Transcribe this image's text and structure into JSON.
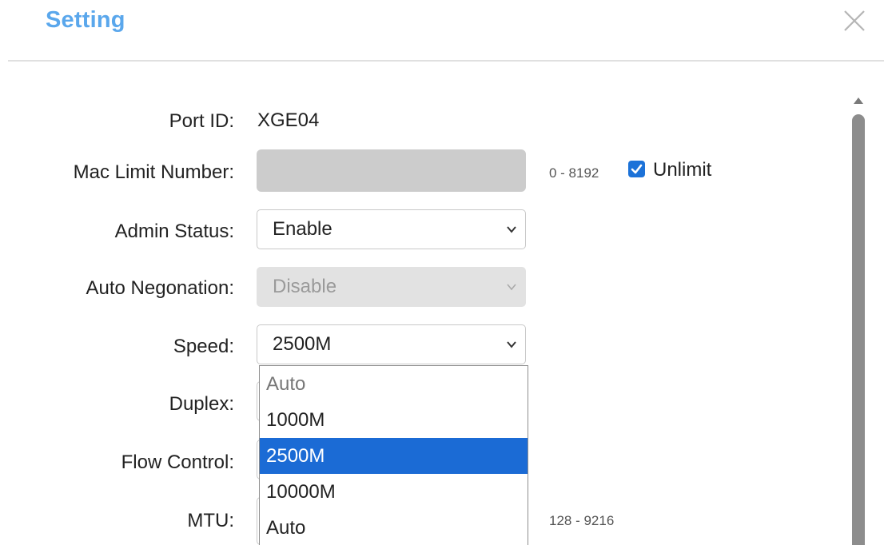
{
  "dialog": {
    "title": "Setting"
  },
  "form": {
    "port_id": {
      "label": "Port ID:",
      "value": "XGE04"
    },
    "mac_limit": {
      "label": "Mac Limit Number:",
      "value": "",
      "range": "0 - 8192",
      "unlimit_label": "Unlimit",
      "unlimit_checked": true
    },
    "admin_status": {
      "label": "Admin Status:",
      "value": "Enable"
    },
    "auto_negotiation": {
      "label": "Auto Negonation:",
      "value": "Disable"
    },
    "speed": {
      "label": "Speed:",
      "value": "2500M"
    },
    "duplex": {
      "label": "Duplex:"
    },
    "flow_control": {
      "label": "Flow Control:"
    },
    "mtu": {
      "label": "MTU:",
      "range": "128 - 9216"
    }
  },
  "speed_dropdown": {
    "options": [
      "Auto",
      "1000M",
      "2500M",
      "10000M",
      "Auto"
    ],
    "selected_index": 2
  },
  "colors": {
    "title": "#5aa7ec",
    "selected_option": "#1b6bd5",
    "checkbox": "#1c72d8"
  }
}
